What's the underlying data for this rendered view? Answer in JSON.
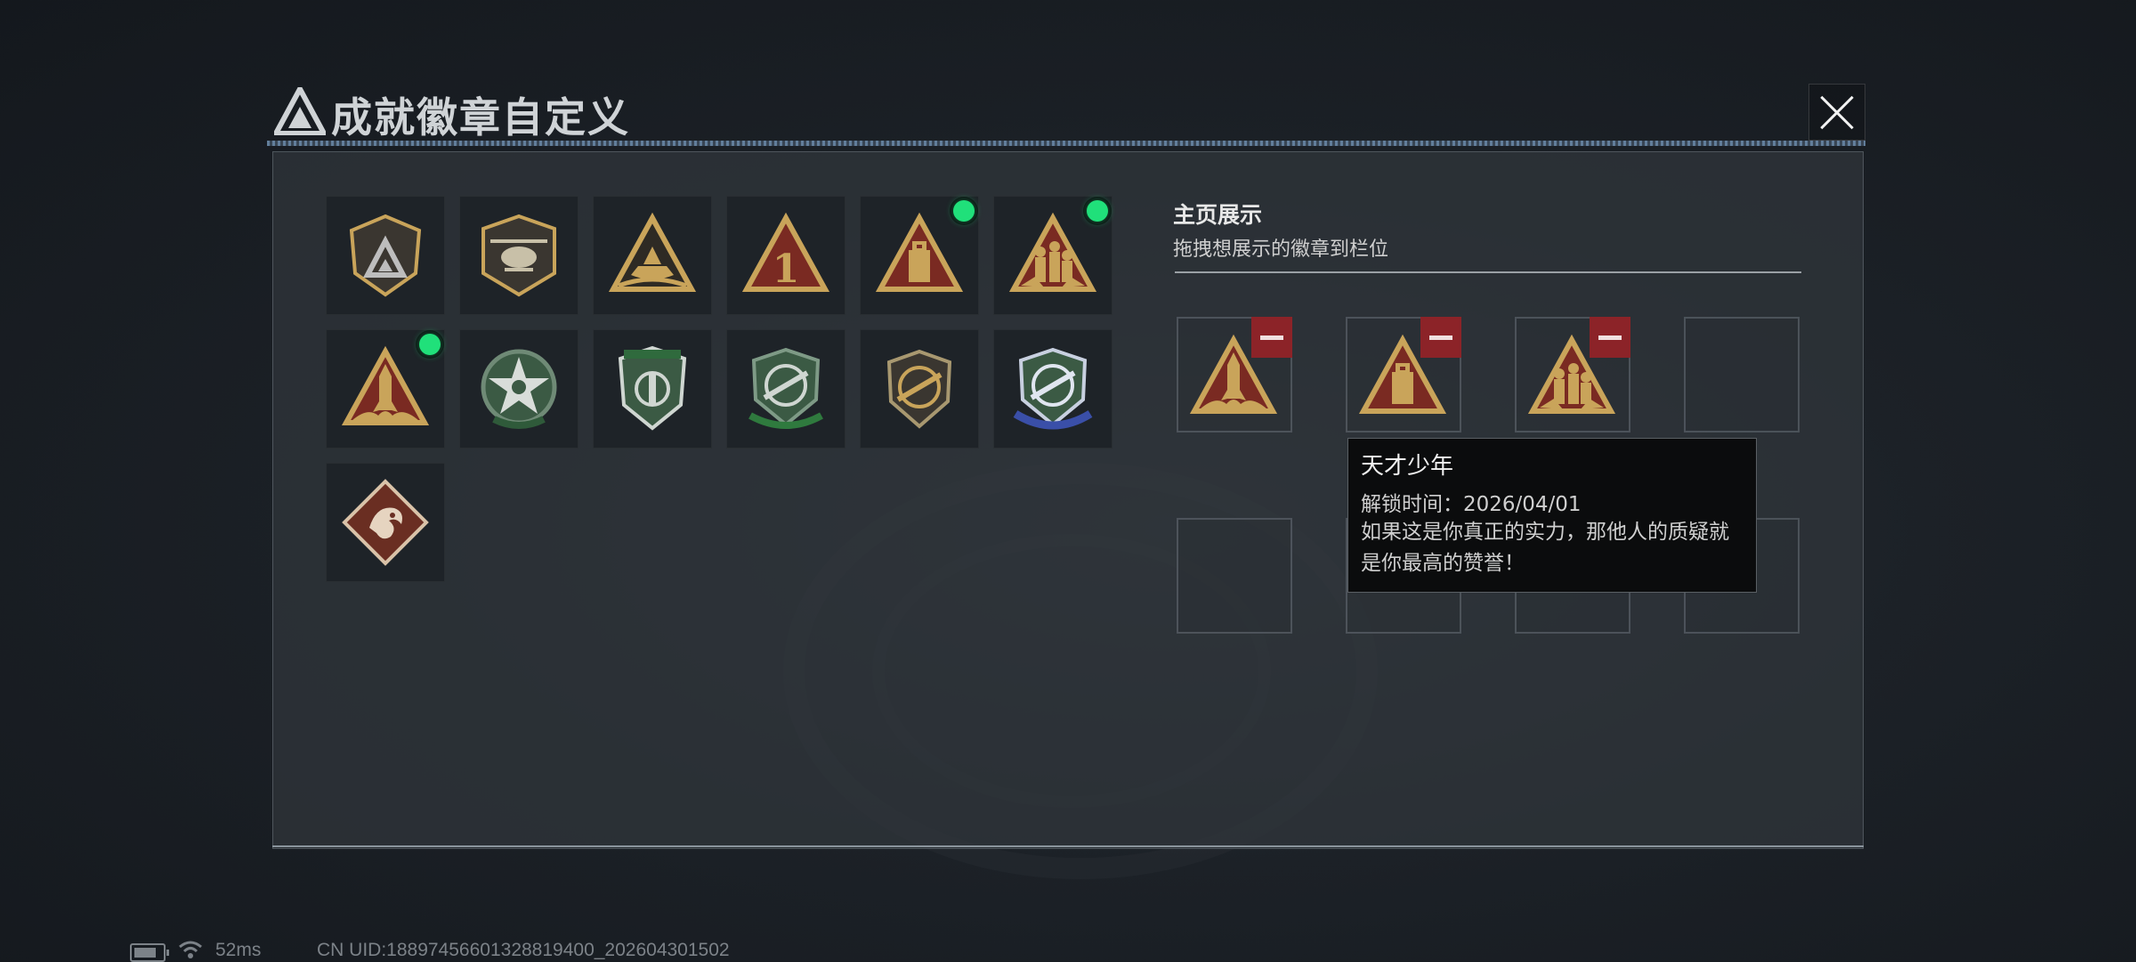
{
  "header": {
    "title": "成就徽章自定义",
    "close_icon": "close-icon"
  },
  "badges": [
    {
      "icon": "shield-logo-badge-icon",
      "equipped": false
    },
    {
      "icon": "helicopter-badge-icon",
      "equipped": false
    },
    {
      "icon": "ship-triangle-badge-icon",
      "equipped": false
    },
    {
      "icon": "number-one-triangle-badge-icon",
      "equipped": false
    },
    {
      "icon": "tower-triangle-badge-icon",
      "equipped": true
    },
    {
      "icon": "soldiers-triangle-badge-icon",
      "equipped": true
    },
    {
      "icon": "rocket-triangle-badge-icon",
      "equipped": true
    },
    {
      "icon": "green-star-badge-icon",
      "equipped": false
    },
    {
      "icon": "green-shield-badge-icon",
      "equipped": false
    },
    {
      "icon": "green-crosshair-rifle-badge-icon",
      "equipped": false
    },
    {
      "icon": "gold-crosshair-rifle-badge-icon",
      "equipped": false
    },
    {
      "icon": "blue-crosshair-rifle-badge-icon",
      "equipped": false
    },
    {
      "icon": "dragon-diamond-badge-icon",
      "equipped": false
    }
  ],
  "display": {
    "title": "主页展示",
    "subtitle": "拖拽想展示的徽章到栏位",
    "slots": [
      {
        "icon": "rocket-triangle-badge-icon",
        "filled": true
      },
      {
        "icon": "tower-triangle-badge-icon",
        "filled": true
      },
      {
        "icon": "soldiers-triangle-badge-icon",
        "filled": true
      },
      {
        "filled": false
      },
      {
        "filled": false
      },
      {
        "filled": false
      },
      {
        "filled": false
      },
      {
        "filled": false
      }
    ],
    "remove_icon": "minus-icon"
  },
  "tooltip": {
    "name": "天才少年",
    "unlock_time": "解锁时间：2026/04/01",
    "description": "如果这是你真正的实力，那他人的质疑就是你最高的赞誉！"
  },
  "footer": {
    "latency": "52ms",
    "uid": "CN UID:18897456601328819400_202604301502"
  },
  "colors": {
    "accent_green": "#20e07a",
    "remove_red": "#8c2328",
    "gold": "#c9a45a"
  }
}
